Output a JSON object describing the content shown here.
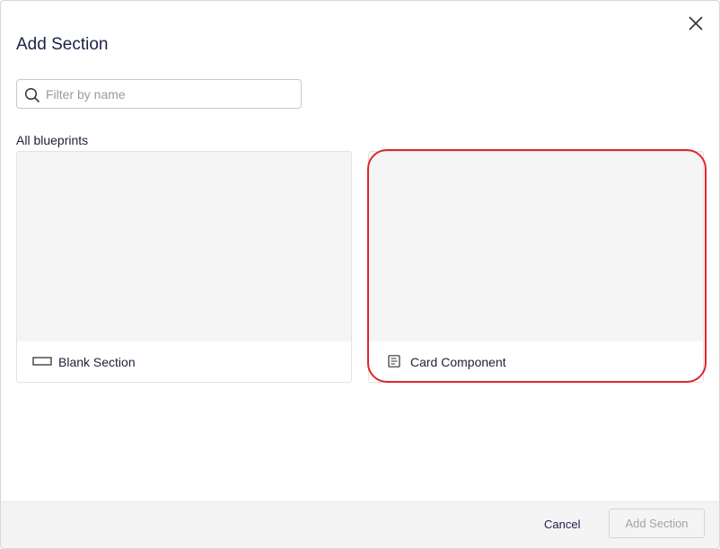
{
  "dialog": {
    "title": "Add Section",
    "close_icon": "close-icon"
  },
  "search": {
    "placeholder": "Filter by name",
    "value": "",
    "icon": "search-icon"
  },
  "blueprints": {
    "label": "All blueprints",
    "items": [
      {
        "label": "Blank Section",
        "icon": "blank-section-icon"
      },
      {
        "label": "Card Component",
        "icon": "card-component-icon",
        "highlighted": true
      }
    ]
  },
  "footer": {
    "cancel_label": "Cancel",
    "add_label": "Add Section",
    "add_disabled": true
  },
  "colors": {
    "highlight": "#e0262a",
    "title": "#1c2147",
    "preview_bg": "#f5f5f5",
    "footer_bg": "#f4f4f4"
  }
}
